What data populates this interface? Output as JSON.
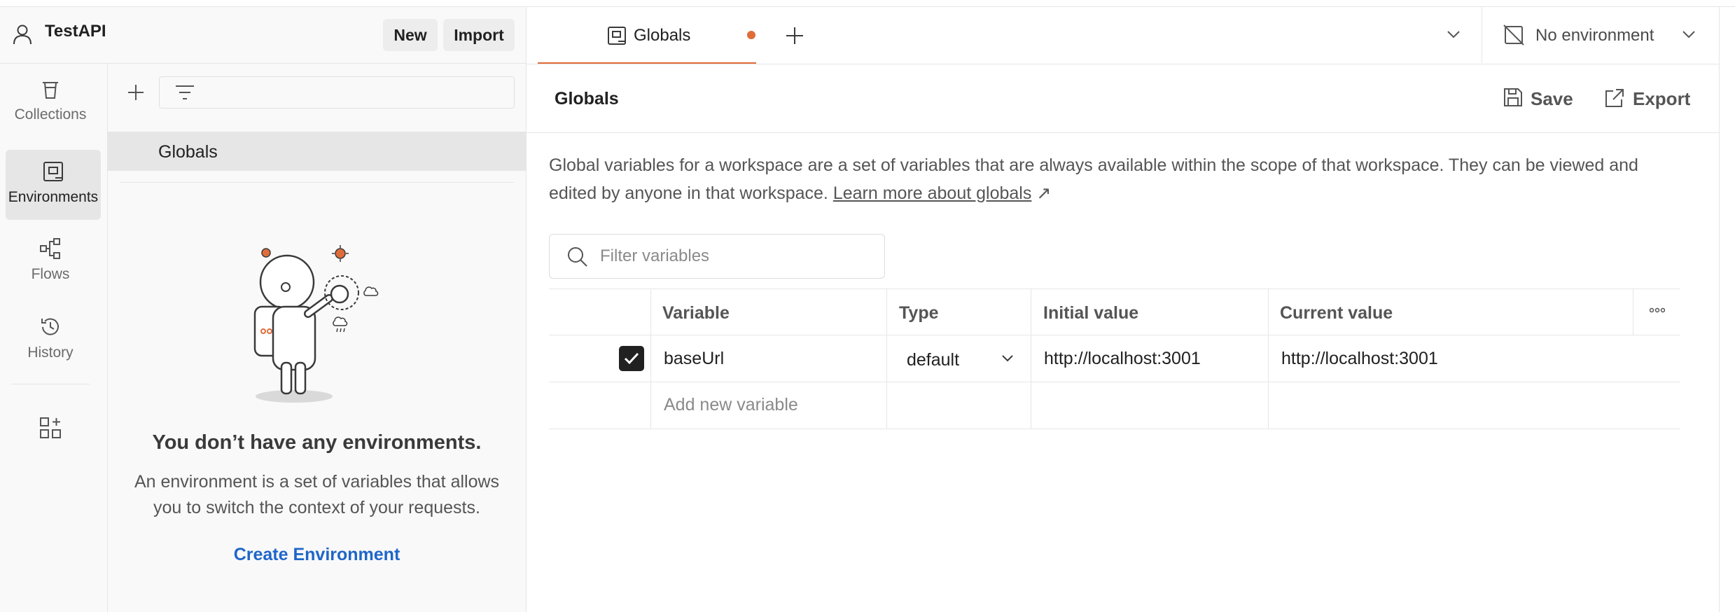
{
  "workspace": {
    "name": "TestAPI",
    "new_label": "New",
    "import_label": "Import"
  },
  "nav": {
    "items": [
      {
        "label": "Collections",
        "icon": "collections-icon"
      },
      {
        "label": "Environments",
        "icon": "environments-icon",
        "active": true
      },
      {
        "label": "Flows",
        "icon": "flows-icon"
      },
      {
        "label": "History",
        "icon": "history-icon"
      }
    ],
    "extra_icon": "add-apps-icon"
  },
  "sidebar": {
    "selected_item": "Globals",
    "empty_title": "You don’t have any environments.",
    "empty_desc": "An environment is a set of variables that allows you to switch the context of your requests.",
    "create_label": "Create Environment"
  },
  "tabs": {
    "active_label": "Globals",
    "unsaved": true,
    "environment_selector": "No environment"
  },
  "globals": {
    "title": "Globals",
    "save_label": "Save",
    "export_label": "Export",
    "description": "Global variables for a workspace are a set of variables that are always available within the scope of that workspace. They can be viewed and edited by anyone in that workspace.",
    "learn_more": "Learn more about globals",
    "learn_more_arrow": "↗",
    "filter_placeholder": "Filter variables",
    "columns": {
      "variable": "Variable",
      "type": "Type",
      "initial": "Initial value",
      "current": "Current value"
    },
    "rows": [
      {
        "enabled": true,
        "variable": "baseUrl",
        "type": "default",
        "initial": "http://localhost:3001",
        "current": "http://localhost:3001"
      }
    ],
    "new_variable_placeholder": "Add new variable"
  },
  "colors": {
    "accent": "#e06c3a",
    "link": "#1f66c9"
  }
}
